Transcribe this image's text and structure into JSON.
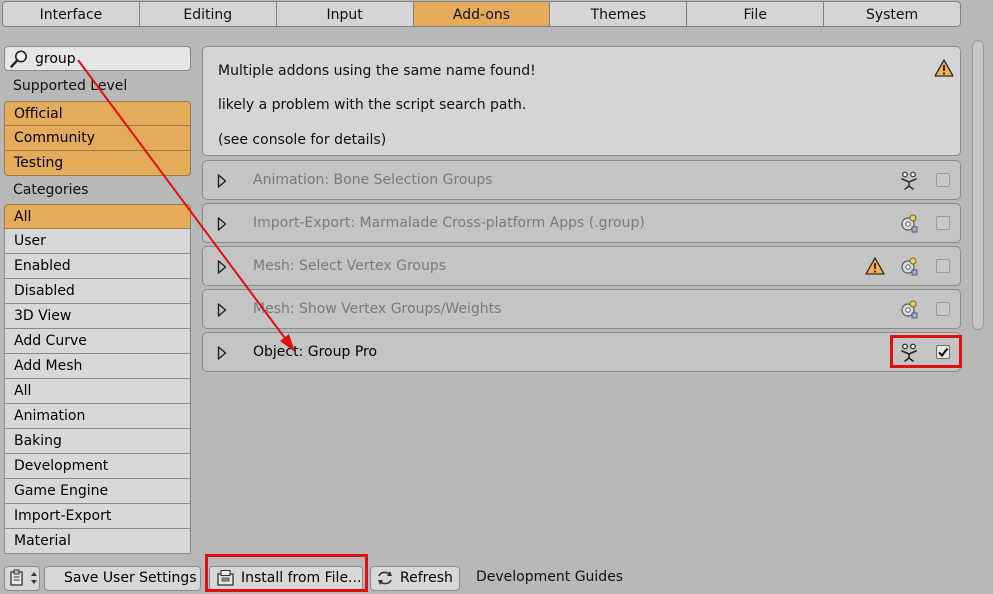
{
  "tabs": [
    {
      "label": "Interface",
      "active": false
    },
    {
      "label": "Editing",
      "active": false
    },
    {
      "label": "Input",
      "active": false
    },
    {
      "label": "Add-ons",
      "active": true
    },
    {
      "label": "Themes",
      "active": false
    },
    {
      "label": "File",
      "active": false
    },
    {
      "label": "System",
      "active": false
    }
  ],
  "sidebar": {
    "search_value": "group",
    "supported_level_label": "Supported Level",
    "supported_levels": [
      "Official",
      "Community",
      "Testing"
    ],
    "categories_label": "Categories",
    "categories": [
      "All",
      "User",
      "Enabled",
      "Disabled",
      "3D View",
      "Add Curve",
      "Add Mesh",
      "All",
      "Animation",
      "Baking",
      "Development",
      "Game Engine",
      "Import-Export",
      "Material"
    ],
    "active_category": "All"
  },
  "warning": {
    "line1": "Multiple addons using the same name found!",
    "line2": "likely a problem with the script search path.",
    "line3": "(see console for details)"
  },
  "addons": [
    {
      "name": "Animation: Bone Selection Groups",
      "support": "community",
      "enabled": false,
      "warning": false
    },
    {
      "name": "Import-Export: Marmalade Cross-platform Apps (.group)",
      "support": "official",
      "enabled": false,
      "warning": false
    },
    {
      "name": "Mesh: Select Vertex Groups",
      "support": "official",
      "enabled": false,
      "warning": true
    },
    {
      "name": "Mesh: Show Vertex Groups/Weights",
      "support": "official",
      "enabled": false,
      "warning": false
    },
    {
      "name": "Object: Group Pro",
      "support": "community",
      "enabled": true,
      "warning": false
    }
  ],
  "footer": {
    "save_label": "Save User Settings",
    "install_label": "Install from File...",
    "refresh_label": "Refresh",
    "dev_guides_label": "Development Guides"
  },
  "colors": {
    "accent": "#e3ab5a",
    "annotation_red": "#e01010"
  }
}
